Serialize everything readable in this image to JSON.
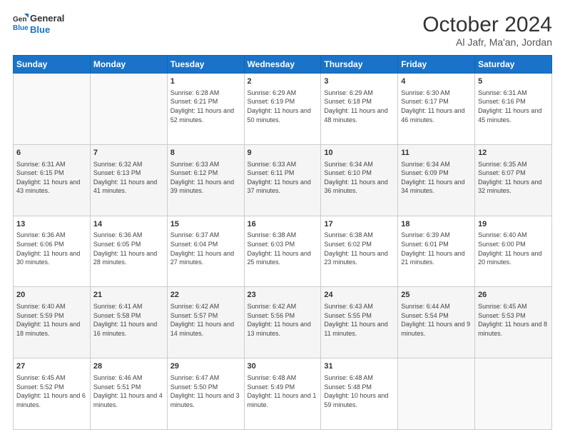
{
  "header": {
    "logo_line1": "General",
    "logo_line2": "Blue",
    "title": "October 2024",
    "subtitle": "Al Jafr, Ma'an, Jordan"
  },
  "weekdays": [
    "Sunday",
    "Monday",
    "Tuesday",
    "Wednesday",
    "Thursday",
    "Friday",
    "Saturday"
  ],
  "weeks": [
    [
      {
        "day": "",
        "sunrise": "",
        "sunset": "",
        "daylight": ""
      },
      {
        "day": "",
        "sunrise": "",
        "sunset": "",
        "daylight": ""
      },
      {
        "day": "1",
        "sunrise": "Sunrise: 6:28 AM",
        "sunset": "Sunset: 6:21 PM",
        "daylight": "Daylight: 11 hours and 52 minutes."
      },
      {
        "day": "2",
        "sunrise": "Sunrise: 6:29 AM",
        "sunset": "Sunset: 6:19 PM",
        "daylight": "Daylight: 11 hours and 50 minutes."
      },
      {
        "day": "3",
        "sunrise": "Sunrise: 6:29 AM",
        "sunset": "Sunset: 6:18 PM",
        "daylight": "Daylight: 11 hours and 48 minutes."
      },
      {
        "day": "4",
        "sunrise": "Sunrise: 6:30 AM",
        "sunset": "Sunset: 6:17 PM",
        "daylight": "Daylight: 11 hours and 46 minutes."
      },
      {
        "day": "5",
        "sunrise": "Sunrise: 6:31 AM",
        "sunset": "Sunset: 6:16 PM",
        "daylight": "Daylight: 11 hours and 45 minutes."
      }
    ],
    [
      {
        "day": "6",
        "sunrise": "Sunrise: 6:31 AM",
        "sunset": "Sunset: 6:15 PM",
        "daylight": "Daylight: 11 hours and 43 minutes."
      },
      {
        "day": "7",
        "sunrise": "Sunrise: 6:32 AM",
        "sunset": "Sunset: 6:13 PM",
        "daylight": "Daylight: 11 hours and 41 minutes."
      },
      {
        "day": "8",
        "sunrise": "Sunrise: 6:33 AM",
        "sunset": "Sunset: 6:12 PM",
        "daylight": "Daylight: 11 hours and 39 minutes."
      },
      {
        "day": "9",
        "sunrise": "Sunrise: 6:33 AM",
        "sunset": "Sunset: 6:11 PM",
        "daylight": "Daylight: 11 hours and 37 minutes."
      },
      {
        "day": "10",
        "sunrise": "Sunrise: 6:34 AM",
        "sunset": "Sunset: 6:10 PM",
        "daylight": "Daylight: 11 hours and 36 minutes."
      },
      {
        "day": "11",
        "sunrise": "Sunrise: 6:34 AM",
        "sunset": "Sunset: 6:09 PM",
        "daylight": "Daylight: 11 hours and 34 minutes."
      },
      {
        "day": "12",
        "sunrise": "Sunrise: 6:35 AM",
        "sunset": "Sunset: 6:07 PM",
        "daylight": "Daylight: 11 hours and 32 minutes."
      }
    ],
    [
      {
        "day": "13",
        "sunrise": "Sunrise: 6:36 AM",
        "sunset": "Sunset: 6:06 PM",
        "daylight": "Daylight: 11 hours and 30 minutes."
      },
      {
        "day": "14",
        "sunrise": "Sunrise: 6:36 AM",
        "sunset": "Sunset: 6:05 PM",
        "daylight": "Daylight: 11 hours and 28 minutes."
      },
      {
        "day": "15",
        "sunrise": "Sunrise: 6:37 AM",
        "sunset": "Sunset: 6:04 PM",
        "daylight": "Daylight: 11 hours and 27 minutes."
      },
      {
        "day": "16",
        "sunrise": "Sunrise: 6:38 AM",
        "sunset": "Sunset: 6:03 PM",
        "daylight": "Daylight: 11 hours and 25 minutes."
      },
      {
        "day": "17",
        "sunrise": "Sunrise: 6:38 AM",
        "sunset": "Sunset: 6:02 PM",
        "daylight": "Daylight: 11 hours and 23 minutes."
      },
      {
        "day": "18",
        "sunrise": "Sunrise: 6:39 AM",
        "sunset": "Sunset: 6:01 PM",
        "daylight": "Daylight: 11 hours and 21 minutes."
      },
      {
        "day": "19",
        "sunrise": "Sunrise: 6:40 AM",
        "sunset": "Sunset: 6:00 PM",
        "daylight": "Daylight: 11 hours and 20 minutes."
      }
    ],
    [
      {
        "day": "20",
        "sunrise": "Sunrise: 6:40 AM",
        "sunset": "Sunset: 5:59 PM",
        "daylight": "Daylight: 11 hours and 18 minutes."
      },
      {
        "day": "21",
        "sunrise": "Sunrise: 6:41 AM",
        "sunset": "Sunset: 5:58 PM",
        "daylight": "Daylight: 11 hours and 16 minutes."
      },
      {
        "day": "22",
        "sunrise": "Sunrise: 6:42 AM",
        "sunset": "Sunset: 5:57 PM",
        "daylight": "Daylight: 11 hours and 14 minutes."
      },
      {
        "day": "23",
        "sunrise": "Sunrise: 6:42 AM",
        "sunset": "Sunset: 5:56 PM",
        "daylight": "Daylight: 11 hours and 13 minutes."
      },
      {
        "day": "24",
        "sunrise": "Sunrise: 6:43 AM",
        "sunset": "Sunset: 5:55 PM",
        "daylight": "Daylight: 11 hours and 11 minutes."
      },
      {
        "day": "25",
        "sunrise": "Sunrise: 6:44 AM",
        "sunset": "Sunset: 5:54 PM",
        "daylight": "Daylight: 11 hours and 9 minutes."
      },
      {
        "day": "26",
        "sunrise": "Sunrise: 6:45 AM",
        "sunset": "Sunset: 5:53 PM",
        "daylight": "Daylight: 11 hours and 8 minutes."
      }
    ],
    [
      {
        "day": "27",
        "sunrise": "Sunrise: 6:45 AM",
        "sunset": "Sunset: 5:52 PM",
        "daylight": "Daylight: 11 hours and 6 minutes."
      },
      {
        "day": "28",
        "sunrise": "Sunrise: 6:46 AM",
        "sunset": "Sunset: 5:51 PM",
        "daylight": "Daylight: 11 hours and 4 minutes."
      },
      {
        "day": "29",
        "sunrise": "Sunrise: 6:47 AM",
        "sunset": "Sunset: 5:50 PM",
        "daylight": "Daylight: 11 hours and 3 minutes."
      },
      {
        "day": "30",
        "sunrise": "Sunrise: 6:48 AM",
        "sunset": "Sunset: 5:49 PM",
        "daylight": "Daylight: 11 hours and 1 minute."
      },
      {
        "day": "31",
        "sunrise": "Sunrise: 6:48 AM",
        "sunset": "Sunset: 5:48 PM",
        "daylight": "Daylight: 10 hours and 59 minutes."
      },
      {
        "day": "",
        "sunrise": "",
        "sunset": "",
        "daylight": ""
      },
      {
        "day": "",
        "sunrise": "",
        "sunset": "",
        "daylight": ""
      }
    ]
  ]
}
